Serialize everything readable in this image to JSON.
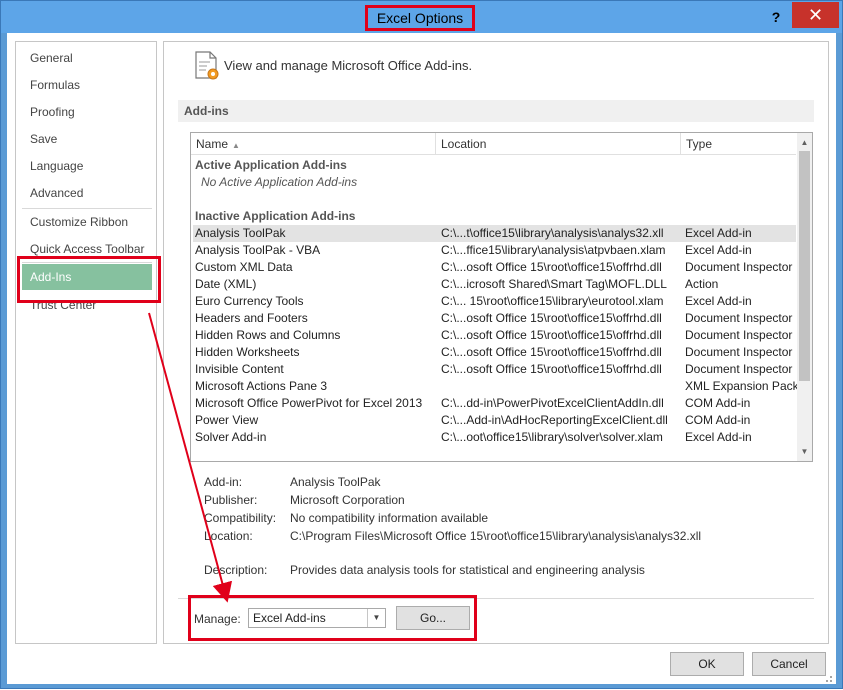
{
  "window": {
    "title": "Excel Options",
    "help": "?",
    "close": "✕"
  },
  "sidebar": {
    "items": [
      {
        "label": "General"
      },
      {
        "label": "Formulas"
      },
      {
        "label": "Proofing"
      },
      {
        "label": "Save"
      },
      {
        "label": "Language"
      },
      {
        "label": "Advanced"
      },
      {
        "label": "Customize Ribbon"
      },
      {
        "label": "Quick Access Toolbar"
      },
      {
        "label": "Add-Ins"
      },
      {
        "label": "Trust Center"
      }
    ]
  },
  "main": {
    "header": "View and manage Microsoft Office Add-ins.",
    "section": "Add-ins",
    "columns": [
      "Name",
      "Location",
      "Type"
    ],
    "active_group": "Active Application Add-ins",
    "active_empty": "No Active Application Add-ins",
    "inactive_group": "Inactive Application Add-ins",
    "rows": [
      {
        "name": "Analysis ToolPak",
        "location": "C:\\...t\\office15\\library\\analysis\\analys32.xll",
        "type": "Excel Add-in"
      },
      {
        "name": "Analysis ToolPak - VBA",
        "location": "C:\\...ffice15\\library\\analysis\\atpvbaen.xlam",
        "type": "Excel Add-in"
      },
      {
        "name": "Custom XML Data",
        "location": "C:\\...osoft Office 15\\root\\office15\\offrhd.dll",
        "type": "Document Inspector"
      },
      {
        "name": "Date (XML)",
        "location": "C:\\...icrosoft Shared\\Smart Tag\\MOFL.DLL",
        "type": "Action"
      },
      {
        "name": "Euro Currency Tools",
        "location": "C:\\... 15\\root\\office15\\library\\eurotool.xlam",
        "type": "Excel Add-in"
      },
      {
        "name": "Headers and Footers",
        "location": "C:\\...osoft Office 15\\root\\office15\\offrhd.dll",
        "type": "Document Inspector"
      },
      {
        "name": "Hidden Rows and Columns",
        "location": "C:\\...osoft Office 15\\root\\office15\\offrhd.dll",
        "type": "Document Inspector"
      },
      {
        "name": "Hidden Worksheets",
        "location": "C:\\...osoft Office 15\\root\\office15\\offrhd.dll",
        "type": "Document Inspector"
      },
      {
        "name": "Invisible Content",
        "location": "C:\\...osoft Office 15\\root\\office15\\offrhd.dll",
        "type": "Document Inspector"
      },
      {
        "name": "Microsoft Actions Pane 3",
        "location": "",
        "type": "XML Expansion Pack"
      },
      {
        "name": "Microsoft Office PowerPivot for Excel 2013",
        "location": "C:\\...dd-in\\PowerPivotExcelClientAddIn.dll",
        "type": "COM Add-in"
      },
      {
        "name": "Power View",
        "location": "C:\\...Add-in\\AdHocReportingExcelClient.dll",
        "type": "COM Add-in"
      },
      {
        "name": "Solver Add-in",
        "location": "C:\\...oot\\office15\\library\\solver\\solver.xlam",
        "type": "Excel Add-in"
      }
    ],
    "details": [
      {
        "label": "Add-in:",
        "value": "Analysis ToolPak"
      },
      {
        "label": "Publisher:",
        "value": "Microsoft Corporation"
      },
      {
        "label": "Compatibility:",
        "value": "No compatibility information available"
      },
      {
        "label": "Location:",
        "value": "C:\\Program Files\\Microsoft Office 15\\root\\office15\\library\\analysis\\analys32.xll"
      },
      {
        "label": "Description:",
        "value": "Provides data analysis tools for statistical and engineering analysis"
      }
    ],
    "manage_label": "Manage:",
    "manage_value": "Excel Add-ins",
    "go_label": "Go..."
  },
  "buttons": {
    "ok": "OK",
    "cancel": "Cancel"
  },
  "colors": {
    "titlebar": "#5da5e8",
    "highlight": "#e0001a",
    "active_nav": "#86c19f"
  }
}
